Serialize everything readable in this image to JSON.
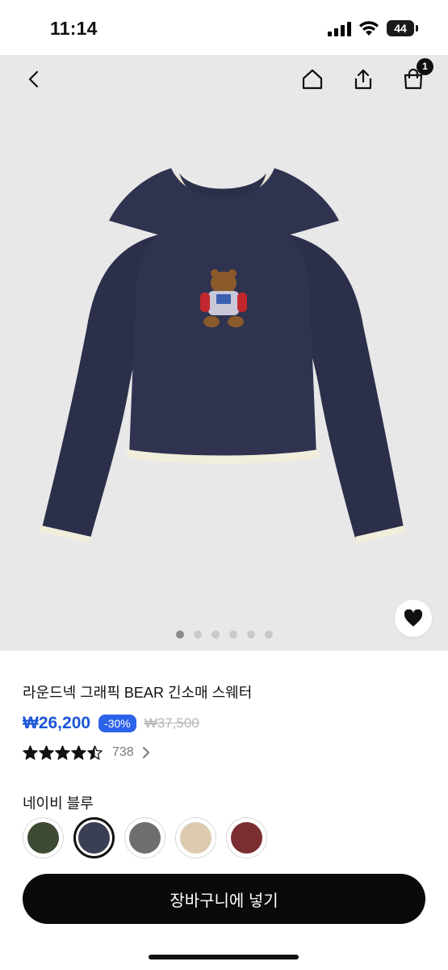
{
  "status_bar": {
    "time": "11:14",
    "battery": "44"
  },
  "nav": {
    "cart_badge": "1"
  },
  "carousel": {
    "total": 6,
    "active_index": 0
  },
  "product": {
    "title": "라운드넥 그래픽 BEAR 긴소매 스웨터",
    "price": "₩26,200",
    "discount": "-30%",
    "original_price": "₩37,500",
    "rating": 4.5,
    "review_count": "738"
  },
  "color": {
    "selected_label": "네이비 블루",
    "options": [
      {
        "name": "olive",
        "hex": "#3f4a34"
      },
      {
        "name": "navy",
        "hex": "#3a3f54"
      },
      {
        "name": "gray",
        "hex": "#6e6e6e"
      },
      {
        "name": "beige",
        "hex": "#dccbb0"
      },
      {
        "name": "burgundy",
        "hex": "#7a2e31"
      }
    ],
    "selected_index": 1
  },
  "cta": {
    "label": "장바구니에 넣기"
  },
  "colors": {
    "accent": "#1a55d6",
    "badge": "#2d63e8",
    "sweater": "#2b2f4a"
  }
}
